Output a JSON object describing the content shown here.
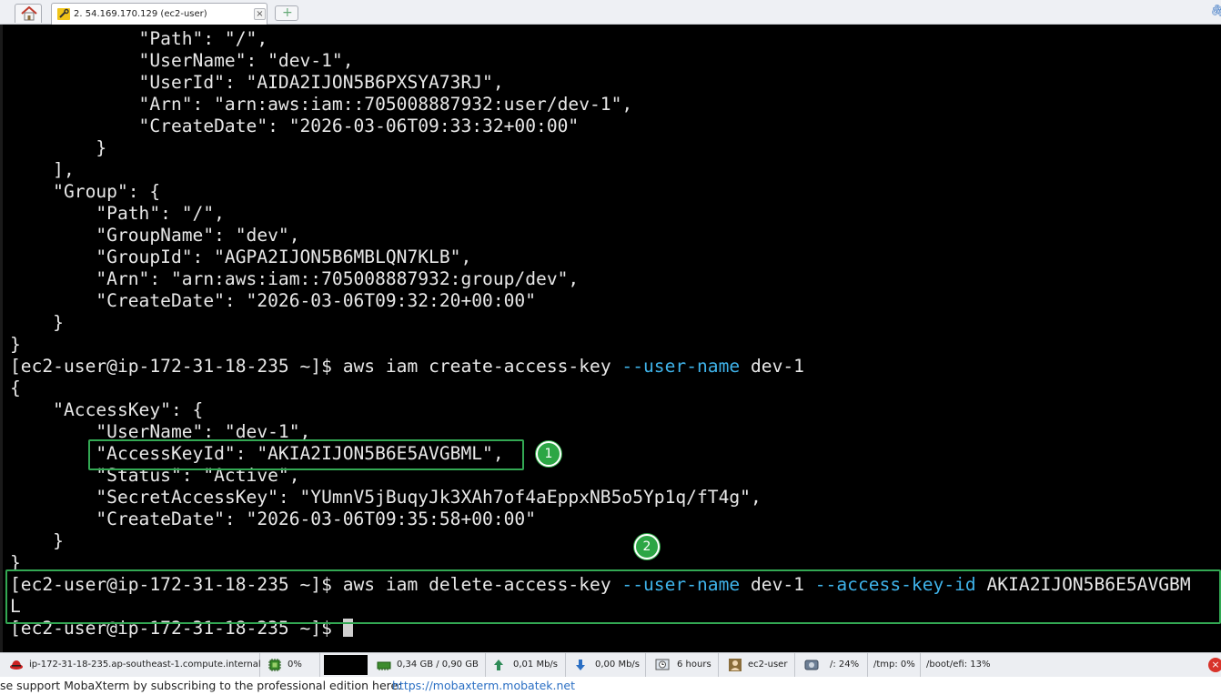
{
  "tabs": {
    "active_tab_label": "2. 54.169.170.129 (ec2-user)",
    "close_glyph": "×",
    "new_tab_glyph": "+"
  },
  "terminal": {
    "lines": [
      "            \"Path\": \"/\",",
      "            \"UserName\": \"dev-1\",",
      "            \"UserId\": \"AIDA2IJON5B6PXSYA73RJ\",",
      "            \"Arn\": \"arn:aws:iam::705008887932:user/dev-1\",",
      "            \"CreateDate\": \"2026-03-06T09:33:32+00:00\"",
      "        }",
      "    ],",
      "    \"Group\": {",
      "        \"Path\": \"/\",",
      "        \"GroupName\": \"dev\",",
      "        \"GroupId\": \"AGPA2IJON5B6MBLQN7KLB\",",
      "        \"Arn\": \"arn:aws:iam::705008887932:group/dev\",",
      "        \"CreateDate\": \"2026-03-06T09:32:20+00:00\"",
      "    }",
      "}"
    ],
    "create_cmd": {
      "prompt": "[ec2-user@ip-172-31-18-235 ~]$ ",
      "cmd": "aws iam create-access-key ",
      "flag1": "--user-name",
      "arg1": " dev-1"
    },
    "output_lines": [
      "{",
      "    \"AccessKey\": {",
      "        \"UserName\": \"dev-1\",",
      "        \"AccessKeyId\": \"AKIA2IJON5B6E5AVGBML\",",
      "        \"Status\": \"Active\",",
      "        \"SecretAccessKey\": \"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\",",
      "        \"CreateDate\": \"2026-03-06T09:35:58+00:00\"",
      "    }",
      "}"
    ],
    "delete_cmd": {
      "prompt": "[ec2-user@ip-172-31-18-235 ~]$ ",
      "cmd": "aws iam delete-access-key ",
      "flag1": "--user-name",
      "arg1": " dev-1 ",
      "flag2": "--access-key-id",
      "arg2": " AKIA2IJON5B6E5AVGBM"
    },
    "wrap_line": "L",
    "final_prompt": "[ec2-user@ip-172-31-18-235 ~]$ "
  },
  "annotations": {
    "badge1": "1",
    "badge2": "2"
  },
  "statusbar": {
    "host": "ip-172-31-18-235.ap-southeast-1.compute.internal",
    "cpu": "0%",
    "memory": "0,34 GB / 0,90 GB",
    "upload": "0,01 Mb/s",
    "download": "0,00 Mb/s",
    "uptime": "6 hours",
    "user": "ec2-user",
    "disk_root": "/: 24%",
    "disk_tmp": "/tmp: 0%",
    "disk_efi": "/boot/efi: 13%",
    "close_glyph": "×"
  },
  "support": {
    "message": "se support MobaXterm by subscribing to the professional edition here:",
    "link": "https://mobaxterm.mobatek.net"
  },
  "colors": {
    "terminal_bg": "#000000",
    "terminal_fg": "#e8e8e8",
    "flag_cyan": "#3fb3ea",
    "annotation_green": "#33a853",
    "link_blue": "#2a6fc4"
  }
}
